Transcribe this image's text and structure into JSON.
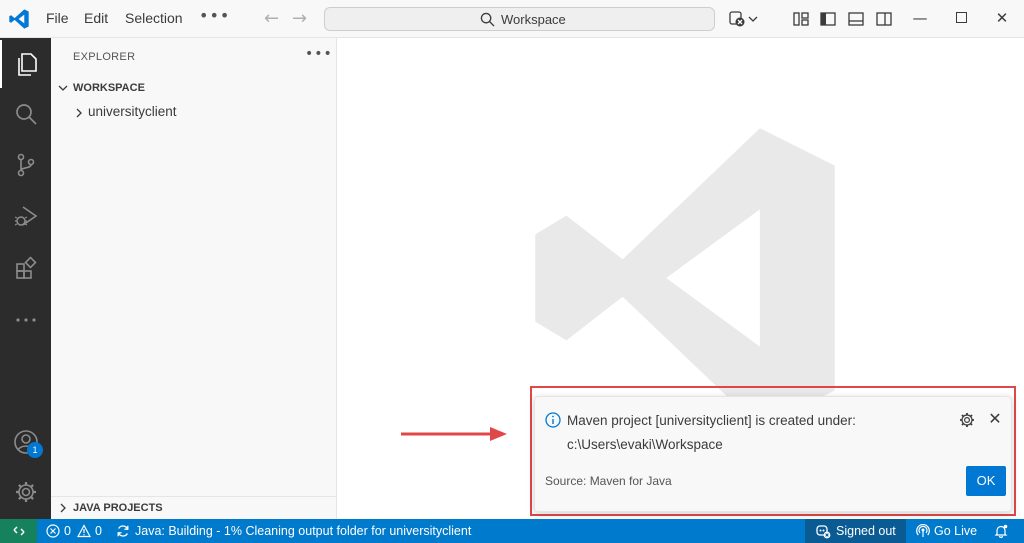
{
  "menu": {
    "file": "File",
    "edit": "Edit",
    "selection": "Selection",
    "more": "•••"
  },
  "command_center": {
    "label": "Workspace"
  },
  "sidebar": {
    "title": "EXPLORER",
    "more": "•••",
    "workspace_header": "WORKSPACE",
    "tree_items": [
      "universityclient"
    ],
    "java_projects_header": "JAVA PROJECTS"
  },
  "activity_bar": {
    "accounts_badge": "1"
  },
  "notification": {
    "message_line1": "Maven project [universityclient] is created under:",
    "message_line2": "c:\\Users\\evaki\\Workspace",
    "source": "Source: Maven for Java",
    "ok_label": "OK"
  },
  "statusbar": {
    "errors": "0",
    "warnings": "0",
    "java_status": "Java: Building - 1% Cleaning output folder for universityclient",
    "signed_out": "Signed out",
    "go_live": "Go Live"
  },
  "colors": {
    "accent": "#0078d4",
    "statusbar": "#007acc",
    "remote": "#16825d",
    "highlight": "#e04848",
    "annotation_arrow": "#e04848"
  }
}
